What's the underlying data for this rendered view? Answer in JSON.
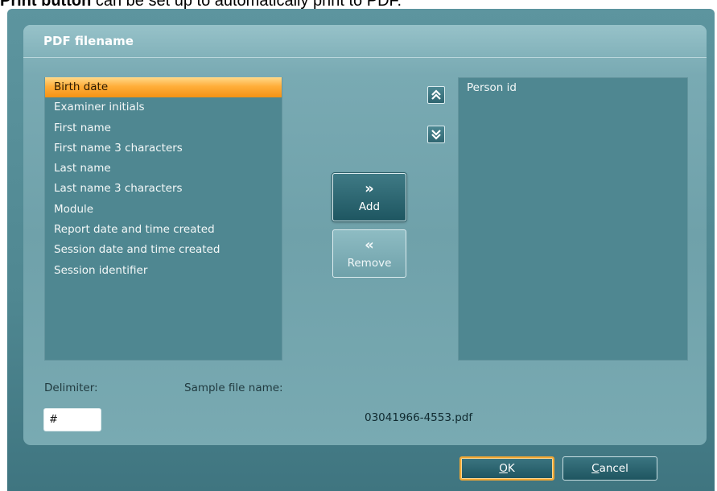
{
  "caption": {
    "bold": "Print button",
    "rest": " can be set up to automatically print to PDF."
  },
  "dialog": {
    "title": "PDF filename"
  },
  "available_fields": [
    "Birth date",
    "Examiner initials",
    "First name",
    "First name 3 characters",
    "Last name",
    "Last name 3 characters",
    "Module",
    "Report date and time created",
    "Session date and time created",
    "Session identifier"
  ],
  "selected_available_field": "Birth date",
  "selected_fields": [
    "Person id"
  ],
  "buttons": {
    "move_up_icon": "double-chevron-up-icon",
    "move_down_icon": "double-chevron-down-icon",
    "add_glyph": "»",
    "add_label": "Add",
    "remove_glyph": "«",
    "remove_label": "Remove",
    "ok_mnemonic": "O",
    "ok_rest": "K",
    "cancel_mnemonic": "C",
    "cancel_rest": "ancel"
  },
  "delimiter": {
    "label": "Delimiter:",
    "value": "#"
  },
  "sample": {
    "label": "Sample file name:",
    "value": "03041966-4553.pdf"
  },
  "colors": {
    "selection": "#f59213",
    "panel": "#79aab3",
    "list_background": "#4f8791",
    "button_dark": "#1f5560",
    "focus_border": "#f2a733"
  }
}
